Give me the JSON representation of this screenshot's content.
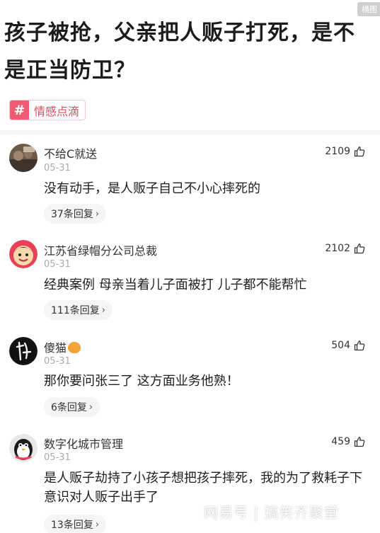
{
  "corner_tag": "横图",
  "title": "孩子被抢，父亲把人贩子打死，是不是正当防卫？",
  "topic": {
    "hash": "#",
    "label": "情感点滴"
  },
  "comments": [
    {
      "author": "不给C就送",
      "date": "05-31",
      "text": "没有动手，是人贩子自己不小心摔死的",
      "replies": "37条回复",
      "likes": "2109"
    },
    {
      "author": "江苏省绿帽分公司总裁",
      "date": "05-31",
      "text": "经典案例 母亲当着儿子面被打 儿子都不能帮忙",
      "replies": "111条回复",
      "likes": "2102"
    },
    {
      "author": "傻猫",
      "date": "05-31",
      "text": "那你要问张三了  这方面业务他熟！",
      "replies": "6条回复",
      "likes": "504"
    },
    {
      "author": "数字化城市管理",
      "date": "05-31",
      "text": "是人贩子劫持了小孩子想把孩子摔死，我的为了救耗子下意识对人贩子出手了",
      "replies": "13条回复",
      "likes": "459"
    }
  ],
  "reply_chevron": "›",
  "watermark": "网易号 | 搞笑齐聚堂"
}
